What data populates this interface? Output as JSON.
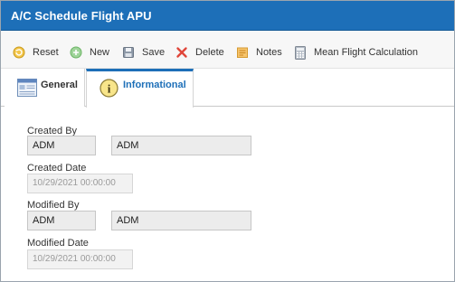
{
  "window": {
    "title": "A/C Schedule Flight APU"
  },
  "toolbar": {
    "items": [
      {
        "label": "Reset",
        "icon": "reset-icon"
      },
      {
        "label": "New",
        "icon": "new-icon"
      },
      {
        "label": "Save",
        "icon": "save-icon"
      },
      {
        "label": "Delete",
        "icon": "delete-icon"
      },
      {
        "label": "Notes",
        "icon": "notes-icon"
      },
      {
        "label": "Mean Flight Calculation",
        "icon": "calculator-icon"
      }
    ]
  },
  "tabs": [
    {
      "label": "General",
      "icon": "general-form-icon",
      "active": false
    },
    {
      "label": "Informational",
      "icon": "info-icon",
      "active": true
    }
  ],
  "form": {
    "created_by": {
      "label": "Created By",
      "value1": "ADM",
      "value2": "ADM"
    },
    "created_date": {
      "label": "Created Date",
      "value": "10/29/2021 00:00:00"
    },
    "modified_by": {
      "label": "Modified By",
      "value1": "ADM",
      "value2": "ADM"
    },
    "modified_date": {
      "label": "Modified Date",
      "value": "10/29/2021 00:00:00"
    }
  },
  "colors": {
    "title_bar": "#1d6fb8",
    "active_tab_accent": "#1d6fb8"
  }
}
